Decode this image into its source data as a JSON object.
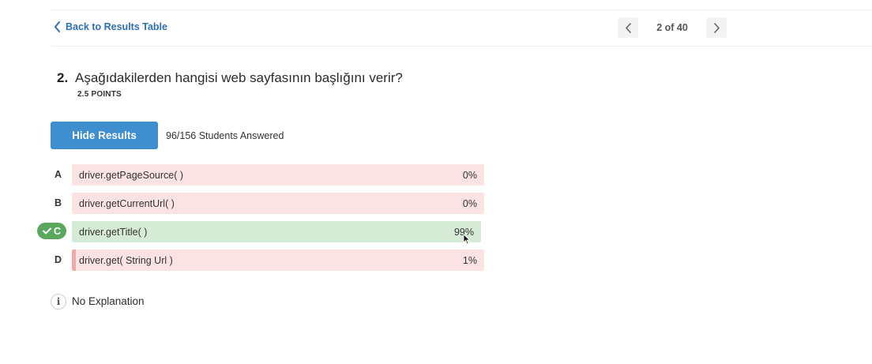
{
  "header": {
    "back_label": "Back to Results Table",
    "pager_label": "2 of 40"
  },
  "question": {
    "number": "2.",
    "text": "Aşağıdakilerden hangisi web sayfasının başlığını verir?",
    "points": "2.5 POINTS"
  },
  "results": {
    "hide_label": "Hide Results",
    "answered": "96/156 Students Answered"
  },
  "options": [
    {
      "letter": "A",
      "text": "driver.getPageSource( )",
      "percent_label": "0%",
      "percent": 0,
      "correct": false
    },
    {
      "letter": "B",
      "text": "driver.getCurrentUrl( )",
      "percent_label": "0%",
      "percent": 0,
      "correct": false
    },
    {
      "letter": "C",
      "text": "driver.getTitle( )",
      "percent_label": "99%",
      "percent": 99,
      "correct": true
    },
    {
      "letter": "D",
      "text": "driver.get( String Url )",
      "percent_label": "1%",
      "percent": 1,
      "correct": false
    }
  ],
  "explanation": {
    "icon_glyph": "i",
    "text": "No Explanation"
  },
  "colors": {
    "accent": "#3f8fd0",
    "link": "#2f6fb5",
    "correct": "#5aa85e",
    "correct_bg": "#d6ebd5",
    "wrong_bg": "#fbe3e3",
    "wrong_fill": "#f2a9a9"
  }
}
